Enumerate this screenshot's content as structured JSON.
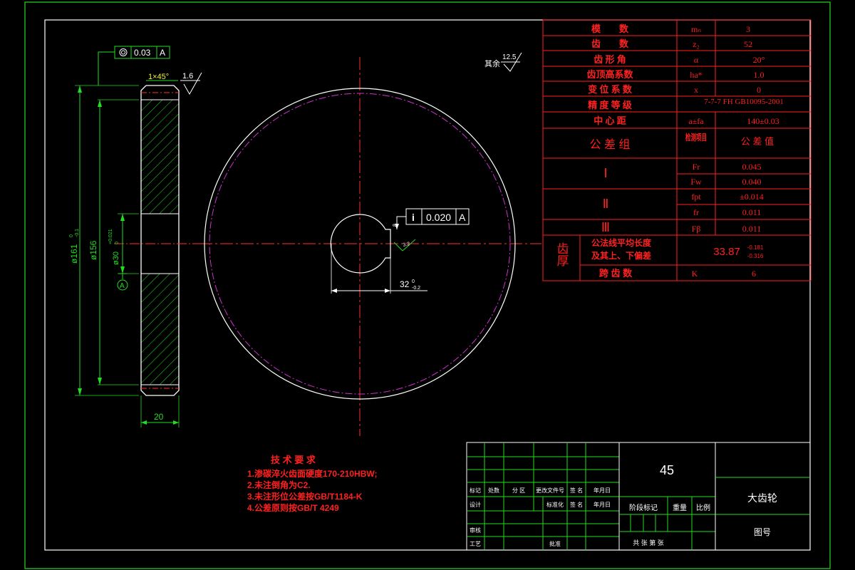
{
  "drawing": {
    "material": "45",
    "part_name": "大齿轮",
    "drawing_no_label": "图号",
    "title_labels": {
      "stage_mark": "阶段标记",
      "weight": "重量",
      "scale": "比例",
      "sheet": "共 张 第 张"
    },
    "signoff_rows": {
      "mark": "标记",
      "count": "处数",
      "zone": "分 区",
      "change_doc": "更改文件号",
      "sign": "签 名",
      "date": "年月日",
      "design": "设计",
      "standardize": "标准化",
      "review": "审核",
      "process": "工艺",
      "approve": "批准"
    }
  },
  "gear_table": {
    "rows": [
      {
        "name": "模　　数",
        "symbol": "mₙ",
        "value": "3"
      },
      {
        "name": "齿　　数",
        "symbol": "z₂",
        "value": "52"
      },
      {
        "name": "齿 形 角",
        "symbol": "α",
        "value": "20°"
      },
      {
        "name": "齿顶高系数",
        "symbol": "ha*",
        "value": "1.0"
      },
      {
        "name": "变 位 系 数",
        "symbol": "x",
        "value": "0"
      },
      {
        "name": "精 度 等 级",
        "value": "7-7-7 FH GB10095-2001"
      },
      {
        "name": "中 心 距",
        "symbol": "a±fa",
        "value": "140±0.03"
      }
    ],
    "tolerance_header": {
      "group": "公 差 组",
      "item": "检测项目",
      "value": "公 差 值"
    },
    "tolerance_groups": [
      {
        "group": "Ⅰ",
        "items": [
          {
            "symbol": "Fr",
            "value": "0.045"
          },
          {
            "symbol": "Fw",
            "value": "0.040"
          }
        ]
      },
      {
        "group": "Ⅱ",
        "items": [
          {
            "symbol": "fpt",
            "value": "±0.014"
          },
          {
            "symbol": "fr",
            "value": "0.011"
          }
        ]
      },
      {
        "group": "Ⅲ",
        "items": [
          {
            "symbol": "Fβ",
            "value": "0.011"
          }
        ]
      }
    ],
    "tooth_thickness": {
      "label": "齿厚",
      "desc_line1": "公法线平均长度",
      "desc_line2": "及其上、下偏差",
      "value": "33.87",
      "upper_dev": "-0.181",
      "lower_dev": "-0.316",
      "span_label": "跨 齿 数",
      "span_symbol": "K",
      "span_value": "6"
    }
  },
  "tech_requirements": {
    "title": "技 术 要 求",
    "items": [
      "1.渗碳淬火齿面硬度170-210HBW;",
      "2.未注倒角为C2.",
      "3.未注形位公差按GB/T1184-K",
      "4.公差原则按GB/T 4249"
    ]
  },
  "section_view": {
    "runout_tolerance": "0.03",
    "runout_datum": "A",
    "chamfer": "1×45°",
    "roughness_top": "1.6",
    "outer_diameter": "ø161",
    "outer_diameter_tol_upper": "0",
    "outer_diameter_tol_lower": "-0.1",
    "root_diameter": "ø156",
    "bore_diameter": "ø30",
    "bore_tol_upper": "+0.021",
    "bore_tol_lower": "0",
    "datum_label": "A",
    "width": "20"
  },
  "front_view": {
    "rest_roughness_label": "其余",
    "rest_roughness_value": "12.5",
    "symmetry_tol_symbol": "i",
    "symmetry_tol_value": "0.020",
    "symmetry_datum": "A",
    "keyway_width_value": "8",
    "keyway_roughness": "3.2",
    "keyway_dim": "32",
    "keyway_dim_upper": "0",
    "keyway_dim_lower": "-0.2"
  }
}
